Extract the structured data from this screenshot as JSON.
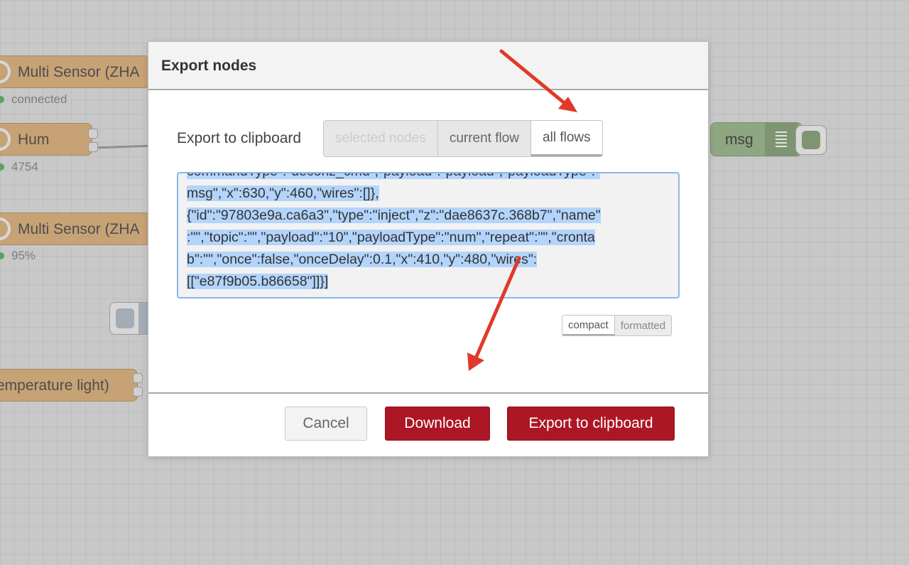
{
  "workspace": {
    "nodes": [
      {
        "label": "Multi Sensor (ZHA",
        "status": "connected"
      },
      {
        "label": "Hum",
        "status": "4754"
      },
      {
        "label": "Multi Sensor (ZHA",
        "status": "95%"
      },
      {
        "label": "emperature light)"
      }
    ],
    "debug_node": {
      "label": "msg"
    }
  },
  "dialog": {
    "title": "Export nodes",
    "export_label": "Export to clipboard",
    "scope_tabs": [
      {
        "label": "selected nodes",
        "state": "disabled"
      },
      {
        "label": "current flow",
        "state": "normal"
      },
      {
        "label": "all flows",
        "state": "active"
      }
    ],
    "code_lines": [
      "commandType\":\"deconz_cmd\",\"payload\":\"payload\",\"payloadType\":\"",
      "msg\",\"x\":630,\"y\":460,\"wires\":[]},",
      "{\"id\":\"97803e9a.ca6a3\",\"type\":\"inject\",\"z\":\"dae8637c.368b7\",\"name\"",
      ":\"\",\"topic\":\"\",\"payload\":\"10\",\"payloadType\":\"num\",\"repeat\":\"\",\"cronta",
      "b\":\"\",\"once\":false,\"onceDelay\":0.1,\"x\":410,\"y\":480,\"wires\":",
      "[[\"e87f9b05.b86658\"]]}]"
    ],
    "format_tabs": [
      {
        "label": "compact",
        "state": "active"
      },
      {
        "label": "formatted",
        "state": "normal"
      }
    ],
    "buttons": {
      "cancel": "Cancel",
      "download": "Download",
      "export": "Export to clipboard"
    }
  },
  "colors": {
    "primary_button": "#ad1625",
    "selection_highlight": "#b3d4fb",
    "annotation_arrow": "#e0392b",
    "node_fill": "#c7a275",
    "debug_node_fill": "#8ea681"
  }
}
